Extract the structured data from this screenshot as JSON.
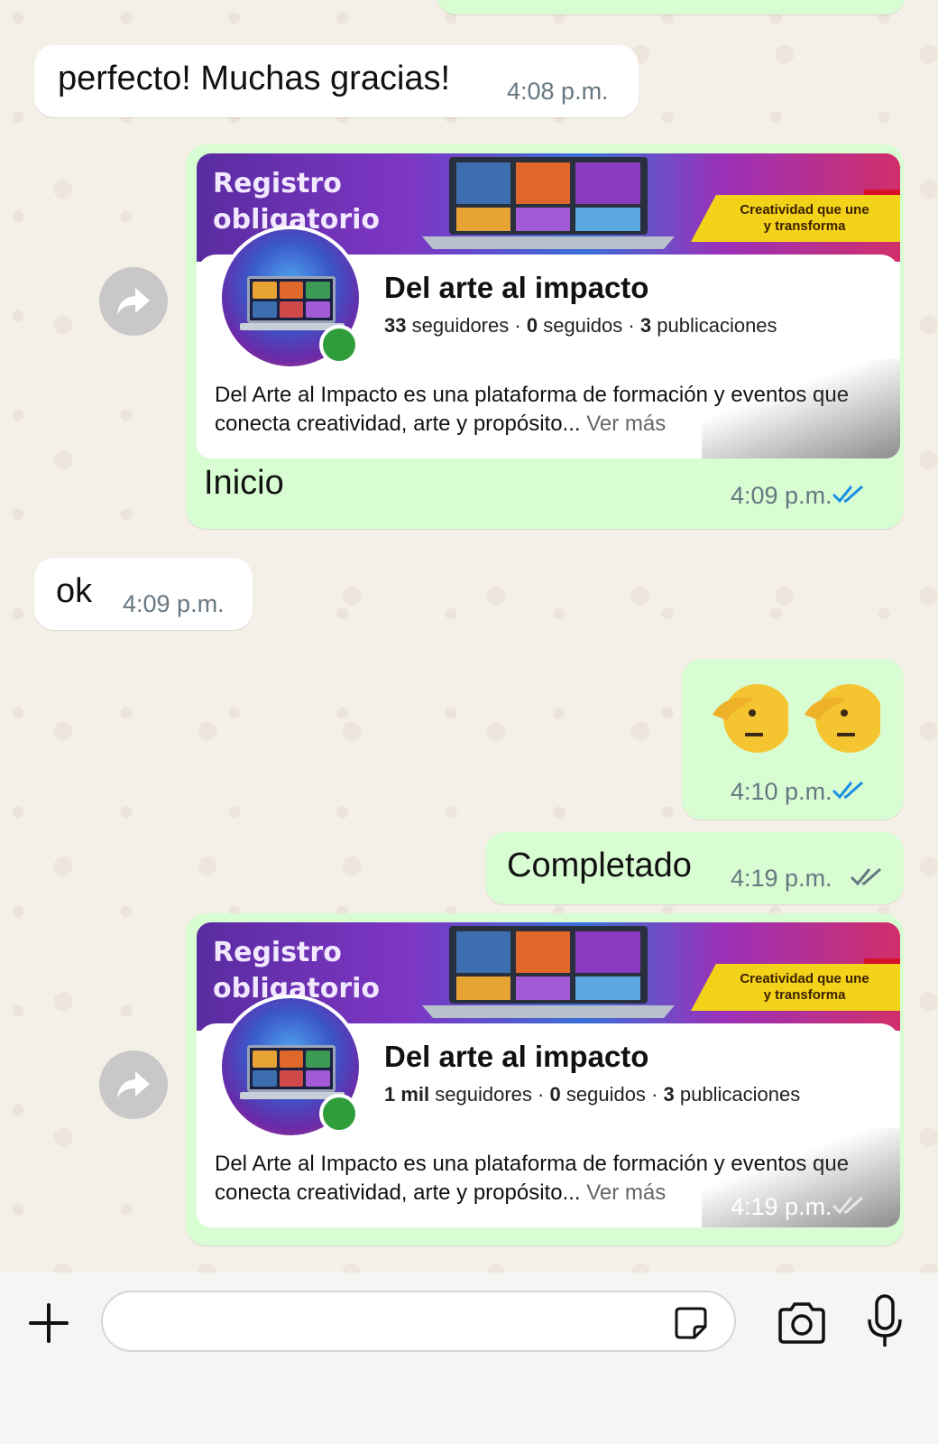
{
  "messages": [
    {
      "type": "incoming",
      "text": "perfecto! Muchas gracias!",
      "time": "4:08 p.m."
    },
    {
      "type": "outgoing-link",
      "caption": "Inicio",
      "time": "4:09 p.m.",
      "status": "read",
      "preview": {
        "banner_text_1": "Registro",
        "banner_text_2": "obligatorio",
        "banner_tag_1": "Creatividad que une",
        "banner_tag_2": "y transforma",
        "title": "Del arte al impacto",
        "followers_count": "33",
        "followers_label": "seguidores",
        "following_count": "0",
        "following_label": "seguidos",
        "posts_count": "3",
        "posts_label": "publicaciones",
        "description": "Del Arte al Impacto es una plataforma de formación y eventos que conecta creatividad, arte y propósito...",
        "more": "Ver más"
      }
    },
    {
      "type": "incoming",
      "text": "ok",
      "time": "4:09 p.m."
    },
    {
      "type": "outgoing-emoji",
      "text": "🫡🫡",
      "time": "4:10 p.m.",
      "status": "read"
    },
    {
      "type": "outgoing",
      "text": "Completado",
      "time": "4:19 p.m.",
      "status": "delivered"
    },
    {
      "type": "outgoing-link",
      "time": "4:19 p.m.",
      "status": "delivered",
      "preview": {
        "banner_text_1": "Registro",
        "banner_text_2": "obligatorio",
        "banner_tag_1": "Creatividad que une",
        "banner_tag_2": "y transforma",
        "title": "Del arte al impacto",
        "followers_count": "1 mil",
        "followers_label": "seguidores",
        "following_count": "0",
        "following_label": "seguidos",
        "posts_count": "3",
        "posts_label": "publicaciones",
        "description": "Del Arte al Impacto es una plataforma de formación y eventos que conecta creatividad, arte y propósito...",
        "more": "Ver más"
      }
    }
  ],
  "colors": {
    "incoming_bubble": "#ffffff",
    "outgoing_bubble": "#d9fdd3",
    "read_ticks": "#1a8fe3",
    "delivered_ticks": "#667781",
    "chat_background": "#f4efe7"
  },
  "icons": {
    "forward": "forward-arrow-icon",
    "attach": "plus-icon",
    "sticker": "sticker-icon",
    "camera": "camera-icon",
    "microphone": "microphone-icon"
  }
}
